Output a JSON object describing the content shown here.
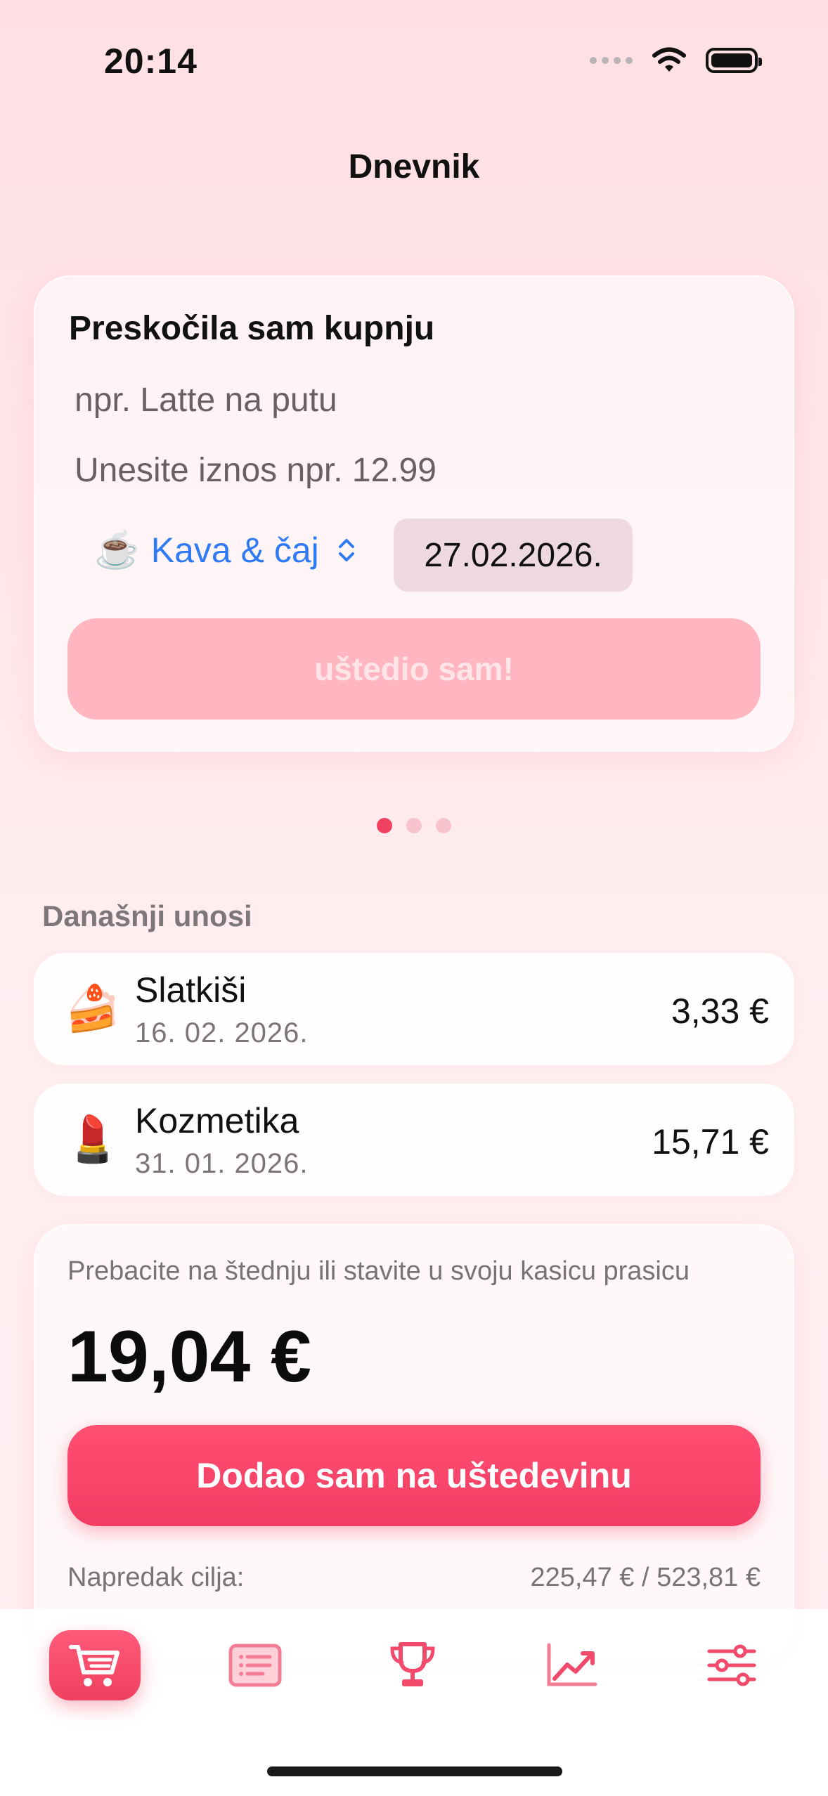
{
  "status_bar": {
    "time": "20:14"
  },
  "page_title": "Dnevnik",
  "entry_card": {
    "title": "Preskočila sam kupnju",
    "name_placeholder": "npr. Latte na putu",
    "amount_placeholder": "Unesite iznos npr. 12.99",
    "category": {
      "emoji": "☕️",
      "label": "Kava & čaj"
    },
    "date": "27.02.2026.",
    "save_label": "uštedio sam!"
  },
  "pager": {
    "count": 3,
    "active": 0
  },
  "todays_entries": {
    "label": "Današnji unosi",
    "items": [
      {
        "emoji": "🍰",
        "name": "Slatkiši",
        "date": "16. 02. 2026.",
        "amount": "3,33 €"
      },
      {
        "emoji": "💄",
        "name": "Kozmetika",
        "date": "31. 01. 2026.",
        "amount": "15,71 €"
      }
    ]
  },
  "summary": {
    "hint": "Prebacite na štednju ili stavite u svoju kasicu prasicu",
    "total": "19,04 €",
    "add_label": "Dodao sam na uštedevinu",
    "goal_label": "Napredak cilja:",
    "goal_value": "225,47 € / 523,81 €"
  },
  "tab_bar": {
    "tabs": [
      "cart-icon",
      "list-icon",
      "trophy-icon",
      "chart-icon",
      "sliders-icon"
    ],
    "active_index": 0
  },
  "colors": {
    "accent": "#f23d63",
    "link": "#2f7bf5",
    "background": "#ffe6ea"
  }
}
